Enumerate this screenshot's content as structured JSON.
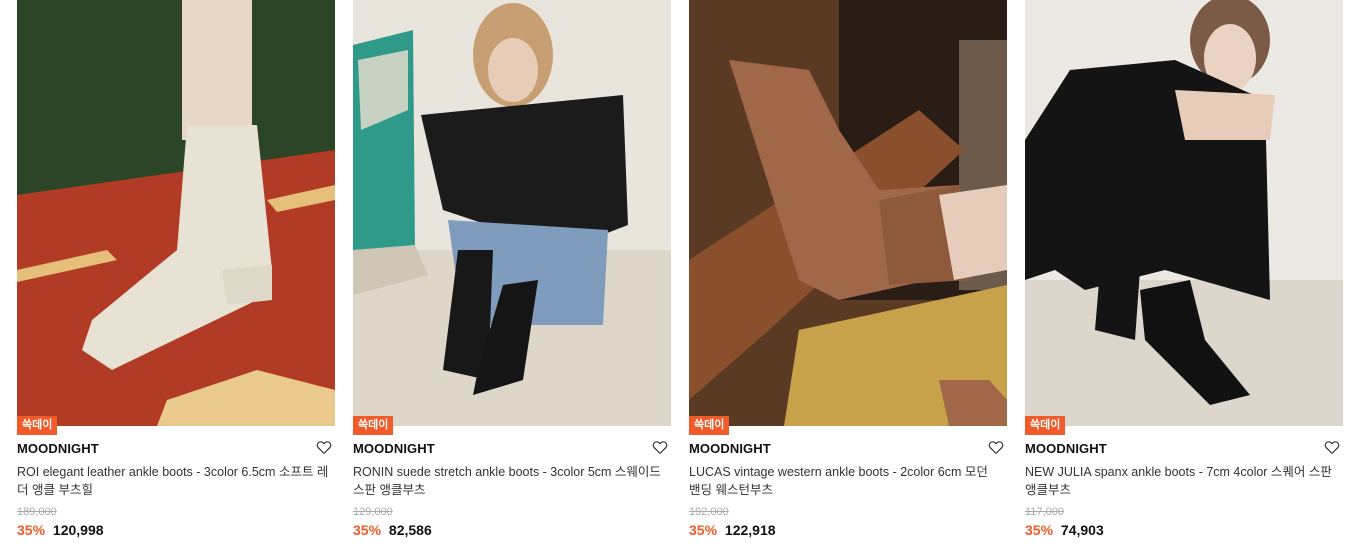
{
  "products": [
    {
      "badge": "쓱데이",
      "brand": "MOODNIGHT",
      "name": "ROI elegant leather ankle boots - 3color 6.5cm 소프트 레더 앵클 부츠힐",
      "original_price": "189,000",
      "discount": "35%",
      "price": "120,998"
    },
    {
      "badge": "쓱데이",
      "brand": "MOODNIGHT",
      "name": "RONIN suede stretch ankle boots - 3color 5cm 스웨이드 스판 앵클부츠",
      "original_price": "129,000",
      "discount": "35%",
      "price": "82,586"
    },
    {
      "badge": "쓱데이",
      "brand": "MOODNIGHT",
      "name": "LUCAS vintage western ankle boots - 2color 6cm 모던 밴딩 웨스턴부츠",
      "original_price": "192,000",
      "discount": "35%",
      "price": "122,918"
    },
    {
      "badge": "쓱데이",
      "brand": "MOODNIGHT",
      "name": "NEW JULIA spanx ankle boots - 7cm 4color 스퀘어 스판 앵클부츠",
      "original_price": "117,000",
      "discount": "35%",
      "price": "74,903"
    }
  ],
  "icons": {
    "wishlist": "heart-outline-icon"
  },
  "colors": {
    "badge_bg": "#f15a29",
    "discount": "#f15a29"
  }
}
